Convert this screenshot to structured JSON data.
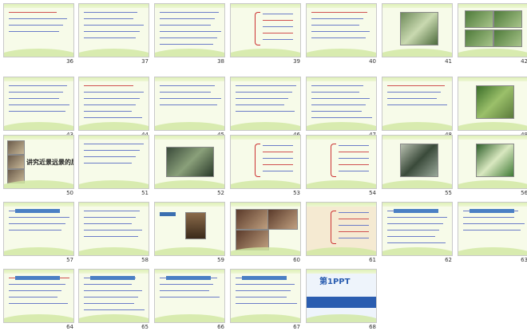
{
  "slides": [
    {
      "num": "36"
    },
    {
      "num": "37"
    },
    {
      "num": "38"
    },
    {
      "num": "39"
    },
    {
      "num": "40"
    },
    {
      "num": "41"
    },
    {
      "num": "42"
    },
    {
      "num": "43"
    },
    {
      "num": "44"
    },
    {
      "num": "45"
    },
    {
      "num": "46"
    },
    {
      "num": "47"
    },
    {
      "num": "48"
    },
    {
      "num": "49"
    },
    {
      "num": "50"
    },
    {
      "num": "51"
    },
    {
      "num": "52"
    },
    {
      "num": "53"
    },
    {
      "num": "54"
    },
    {
      "num": "55"
    },
    {
      "num": "56"
    },
    {
      "num": "57"
    },
    {
      "num": "58"
    },
    {
      "num": "59"
    },
    {
      "num": "60"
    },
    {
      "num": "61"
    },
    {
      "num": "62"
    },
    {
      "num": "63"
    },
    {
      "num": "64"
    },
    {
      "num": "65"
    },
    {
      "num": "66"
    },
    {
      "num": "67"
    },
    {
      "num": "68"
    }
  ],
  "s50": {
    "title": "讲究近景远景的层次"
  },
  "s68": {
    "brand": "第1PPT"
  },
  "colors": {
    "slide_bg": "#f7fbe9",
    "accent_blue": "#2a3f9a",
    "accent_red": "#c33333",
    "wave": "#cfe7a0"
  }
}
